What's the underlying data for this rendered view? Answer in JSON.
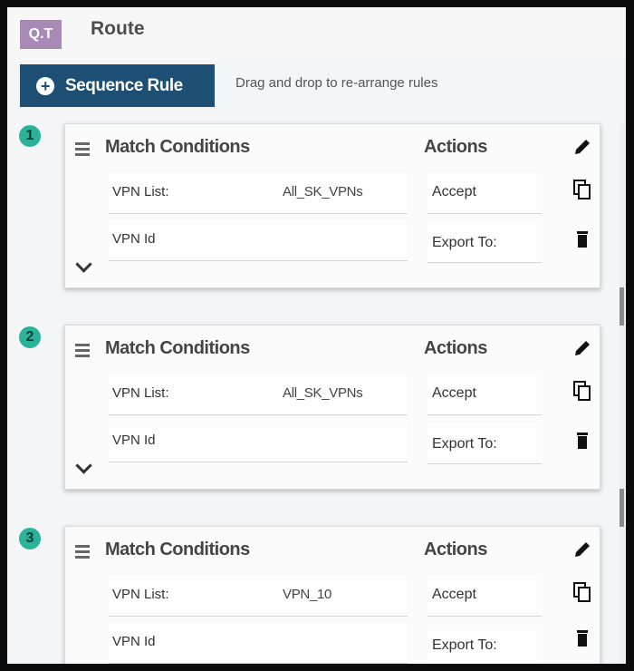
{
  "header": {
    "logo_text": "Q.T",
    "title": "Route"
  },
  "toolbar": {
    "sequence_rule_label": "Sequence Rule",
    "hint": "Drag and drop to re-arrange rules"
  },
  "rules": [
    {
      "number": "1",
      "match_title": "Match Conditions",
      "actions_title": "Actions",
      "conditions": [
        {
          "label": "VPN List:",
          "value": "All_SK_VPNs"
        },
        {
          "label": "VPN Id",
          "value": ""
        }
      ],
      "actions": [
        "Accept",
        "Export To:"
      ]
    },
    {
      "number": "2",
      "match_title": "Match Conditions",
      "actions_title": "Actions",
      "conditions": [
        {
          "label": "VPN List:",
          "value": "All_SK_VPNs"
        },
        {
          "label": "VPN Id",
          "value": ""
        }
      ],
      "actions": [
        "Accept",
        "Export To:"
      ]
    },
    {
      "number": "3",
      "match_title": "Match Conditions",
      "actions_title": "Actions",
      "conditions": [
        {
          "label": "VPN List:",
          "value": "VPN_10"
        },
        {
          "label": "VPN Id",
          "value": ""
        }
      ],
      "actions": [
        "Accept",
        "Export To:"
      ]
    }
  ],
  "icons": {
    "edit": "pencil-icon",
    "copy": "copy-icon",
    "delete": "trash-icon",
    "drag": "drag-handle-icon",
    "expand": "chevron-down-icon"
  },
  "colors": {
    "button_bg": "#1d4f75",
    "sequence_badge": "#2bb39a",
    "logo_bg": "#a78ab5"
  }
}
